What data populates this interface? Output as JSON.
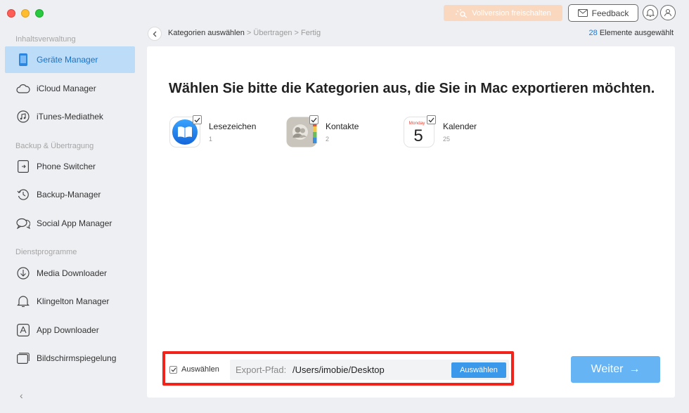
{
  "titlebar": {
    "unlock_label": "Vollversion freischalten",
    "feedback_label": "Feedback"
  },
  "sidebar": {
    "sections": [
      {
        "title": "Inhaltsverwaltung",
        "items": [
          {
            "label": "Geräte Manager",
            "icon": "phone-icon",
            "active": true
          },
          {
            "label": "iCloud Manager",
            "icon": "cloud-icon"
          },
          {
            "label": "iTunes-Mediathek",
            "icon": "music-icon"
          }
        ]
      },
      {
        "title": "Backup & Übertragung",
        "items": [
          {
            "label": "Phone Switcher",
            "icon": "phone-switch-icon"
          },
          {
            "label": "Backup-Manager",
            "icon": "backup-clock-icon"
          },
          {
            "label": "Social App Manager",
            "icon": "chat-icon"
          }
        ]
      },
      {
        "title": "Dienstprogramme",
        "items": [
          {
            "label": "Media Downloader",
            "icon": "download-icon"
          },
          {
            "label": "Klingelton Manager",
            "icon": "bell-icon"
          },
          {
            "label": "App Downloader",
            "icon": "app-store-icon"
          },
          {
            "label": "Bildschirmspiegelung",
            "icon": "mirror-icon"
          }
        ]
      }
    ]
  },
  "breadcrumb": {
    "step1": "Kategorien auswählen",
    "sep": " > ",
    "step2": "Übertragen",
    "step3": "Fertig"
  },
  "selection": {
    "count": "28",
    "suffix": " Elemente ausgewählt"
  },
  "main": {
    "headline": "Wählen Sie bitte die Kategorien aus, die Sie in Mac exportieren möchten.",
    "categories": [
      {
        "label": "Lesezeichen",
        "count": "1",
        "icon": "ibooks-icon",
        "checked": true
      },
      {
        "label": "Kontakte",
        "count": "2",
        "icon": "contacts-icon",
        "checked": true
      },
      {
        "label": "Kalender",
        "count": "25",
        "icon": "calendar-icon",
        "checked": true,
        "calendar_day_name": "Monday",
        "calendar_day": "5"
      }
    ]
  },
  "footer": {
    "select_all_label": "Auswählen",
    "export_path_label": "Export-Pfad:",
    "export_path_value": "/Users/imobie/Desktop",
    "choose_button_label": "Auswählen",
    "next_button_label": "Weiter",
    "next_arrow": "→"
  },
  "colors": {
    "accent": "#3a99ea",
    "highlight_frame": "#f2231b",
    "active_sidebar_bg": "#bcdcf8"
  }
}
